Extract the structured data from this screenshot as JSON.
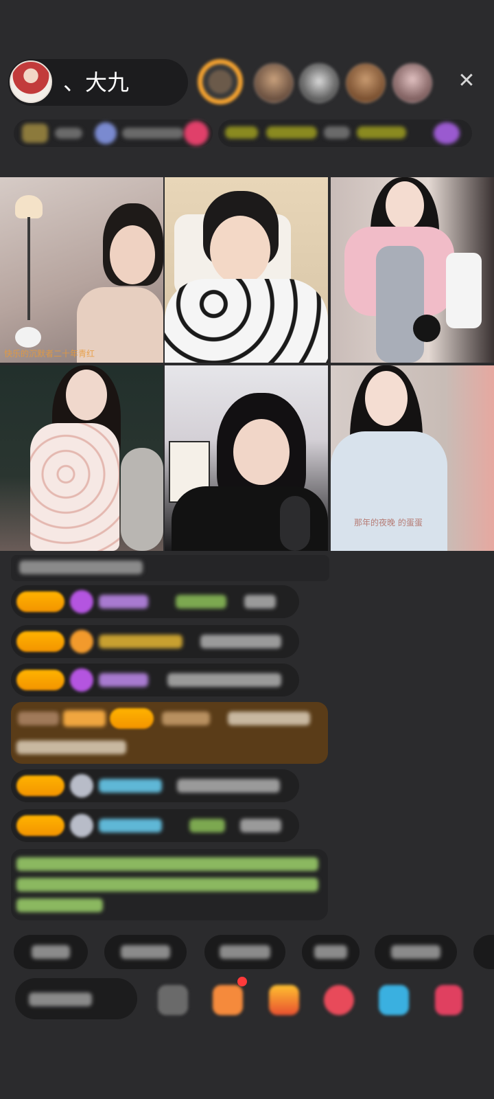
{
  "header": {
    "host_name": "、大九",
    "close_label": "✕"
  },
  "grid": {
    "tile1_caption": "快乐的沉默者二十年青红",
    "tile6_caption": "那年的夜晚 的蛋蛋"
  },
  "colors": {
    "background": "#2b2b2d",
    "badge": "#ffb300",
    "highlight_row": "#5a3c18",
    "green_text": "#9ccc65",
    "purple_icon": "#b455e0",
    "cyan_text": "#5fb7d6"
  },
  "icons": [
    "host-avatar",
    "close-icon",
    "diamond-icon",
    "heart-icon",
    "fan-badge-icon",
    "gift-icon",
    "cart-icon",
    "game-icon"
  ]
}
